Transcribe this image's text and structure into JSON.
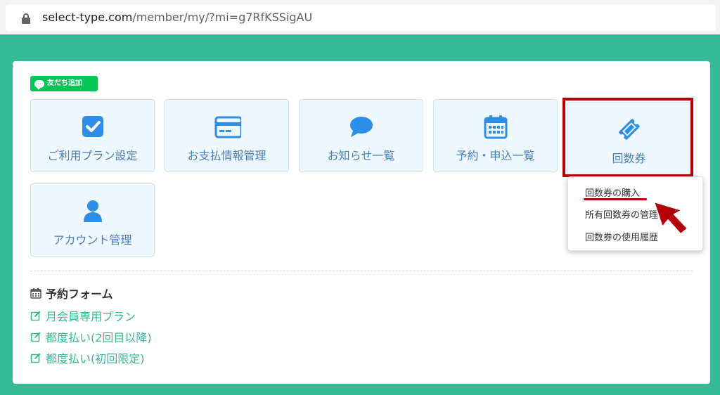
{
  "browser": {
    "url_host": "select-type.com",
    "url_path": "/member/my/?mi=g7RfKSSigAU"
  },
  "line_badge": {
    "label": "友だち追加"
  },
  "tiles": [
    {
      "label": "ご利用プラン設定",
      "icon": "checkbox-icon"
    },
    {
      "label": "お支払情報管理",
      "icon": "credit-card-icon"
    },
    {
      "label": "お知らせ一覧",
      "icon": "chat-bubble-icon"
    },
    {
      "label": "予約・申込一覧",
      "icon": "calendar-icon"
    },
    {
      "label": "回数券",
      "icon": "ticket-icon"
    },
    {
      "label": "アカウント管理",
      "icon": "user-icon"
    }
  ],
  "dropdown": {
    "items": [
      {
        "label": "回数券の購入"
      },
      {
        "label": "所有回数券の管理"
      },
      {
        "label": "回数券の使用履歴"
      }
    ]
  },
  "reservation": {
    "title": "予約フォーム",
    "links": [
      {
        "label": "月会員専用プラン"
      },
      {
        "label": "都度払い(2回目以降)"
      },
      {
        "label": "都度払い(初回限定)"
      }
    ]
  },
  "colors": {
    "page_bg": "#36b995",
    "tile_bg": "#eef6fe",
    "icon_blue": "#2d8ee8",
    "highlight_red": "#b40008",
    "link_green": "#36b995",
    "line_green": "#06c755"
  }
}
